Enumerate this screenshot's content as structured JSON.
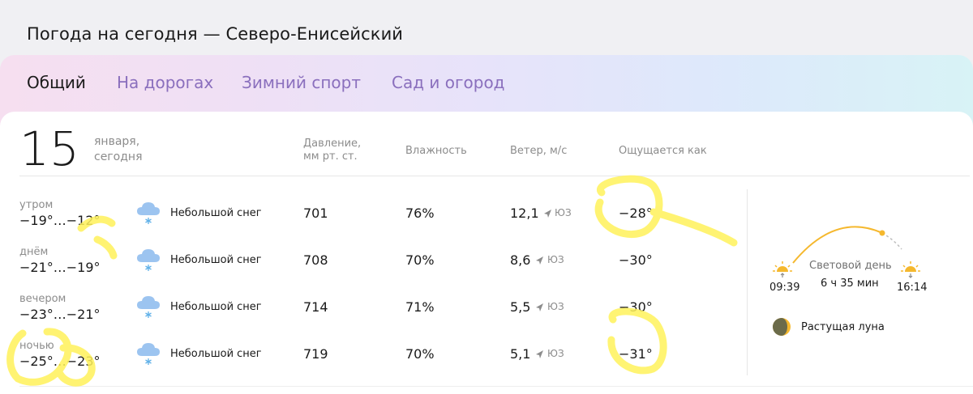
{
  "header": {
    "title": "Погода на сегодня — Северо-Енисейский"
  },
  "tabs": [
    {
      "label": "Общий",
      "active": true
    },
    {
      "label": "На дорогах",
      "active": false
    },
    {
      "label": "Зимний спорт",
      "active": false
    },
    {
      "label": "Сад и огород",
      "active": false
    }
  ],
  "date": {
    "day": "15",
    "month": "января,",
    "today": "сегодня"
  },
  "columns": {
    "pressure_line1": "Давление,",
    "pressure_line2": "мм рт. ст.",
    "humidity": "Влажность",
    "wind": "Ветер, м/с",
    "feels": "Ощущается как"
  },
  "rows": [
    {
      "period": "утром",
      "temps": "−19°…−12°",
      "condition": "Небольшой снег",
      "pressure": "701",
      "humidity": "76%",
      "wind": "12,1",
      "wind_dir": "ЮЗ",
      "feels": "−28°"
    },
    {
      "period": "днём",
      "temps": "−21°…−19°",
      "condition": "Небольшой снег",
      "pressure": "708",
      "humidity": "70%",
      "wind": "8,6",
      "wind_dir": "ЮЗ",
      "feels": "−30°"
    },
    {
      "period": "вечером",
      "temps": "−23°…−21°",
      "condition": "Небольшой снег",
      "pressure": "714",
      "humidity": "71%",
      "wind": "5,5",
      "wind_dir": "ЮЗ",
      "feels": "−30°"
    },
    {
      "period": "ночью",
      "temps": "−25°…−23°",
      "condition": "Небольшой снег",
      "pressure": "719",
      "humidity": "70%",
      "wind": "5,1",
      "wind_dir": "ЮЗ",
      "feels": "−31°"
    }
  ],
  "sun": {
    "sunrise": "09:39",
    "sunset": "16:14",
    "daylight_label": "Световой день",
    "daylight_length": "6 ч 35 мин"
  },
  "moon": {
    "label": "Растущая луна"
  },
  "colors": {
    "accent_tab": "#8a6fbd",
    "highlight": "#fff25a",
    "sun": "#f5b82e"
  },
  "icons": [
    "snow-cloud-icon",
    "wind-arrow-icon",
    "sunrise-icon",
    "sunset-icon",
    "moon-icon"
  ]
}
